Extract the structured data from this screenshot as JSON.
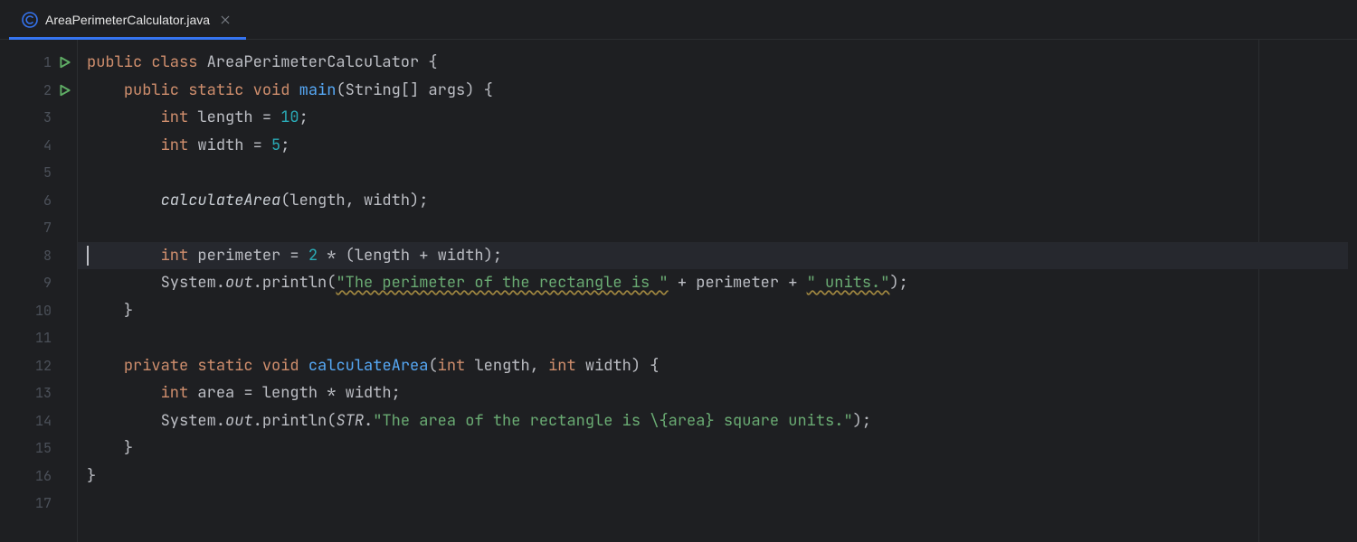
{
  "tab": {
    "title": "AreaPerimeterCalculator.java",
    "icon": "class-icon",
    "close": "×"
  },
  "gutter": {
    "lines": [
      "1",
      "2",
      "3",
      "4",
      "5",
      "6",
      "7",
      "8",
      "9",
      "10",
      "11",
      "12",
      "13",
      "14",
      "15",
      "16",
      "17"
    ],
    "run_markers": [
      1,
      2
    ]
  },
  "current_line": 8,
  "code": {
    "l1": {
      "kw_public": "public",
      "kw_class": "class",
      "cls": "AreaPerimeterCalculator",
      "brace": " {"
    },
    "l2": {
      "indent": "    ",
      "kw_public": "public",
      "kw_static": "static",
      "kw_void": "void",
      "mname": "main",
      "args": "(String[] args) {"
    },
    "l3": {
      "indent": "        ",
      "kw": "int",
      "rest": " length = ",
      "num": "10",
      "semi": ";"
    },
    "l4": {
      "indent": "        ",
      "kw": "int",
      "rest": " width = ",
      "num": "5",
      "semi": ";"
    },
    "l5": {
      "blank": ""
    },
    "l6": {
      "indent": "        ",
      "call": "calculateArea",
      "rest": "(length, width);"
    },
    "l7": {
      "blank": ""
    },
    "l8": {
      "indent": "        ",
      "kw": "int",
      "rest": " perimeter = ",
      "num": "2",
      "tail": " * (length + width);"
    },
    "l9": {
      "indent": "        ",
      "sys": "System.",
      "out": "out",
      "dot": ".",
      "pln": "println",
      "open": "(",
      "s1": "\"The perimeter of the rectangle is \"",
      "mid": " + perimeter + ",
      "s2": "\" units.\"",
      "close": ");"
    },
    "l10": {
      "indent": "    ",
      "brace": "}"
    },
    "l11": {
      "blank": ""
    },
    "l12": {
      "indent": "    ",
      "kw_private": "private",
      "kw_static": "static",
      "kw_void": "void",
      "mname": "calculateArea",
      "args": "(",
      "kw_int1": "int",
      "a1": " length, ",
      "kw_int2": "int",
      "a2": " width) {"
    },
    "l13": {
      "indent": "        ",
      "kw": "int",
      "rest": " area = length * width;"
    },
    "l14": {
      "indent": "        ",
      "sys": "System.",
      "out": "out",
      "dot": ".",
      "pln": "println",
      "open": "(",
      "str": "STR",
      "dot2": ".",
      "s": "\"The area of the rectangle is \\{area} square units.\"",
      "close": ");"
    },
    "l15": {
      "indent": "    ",
      "brace": "}"
    },
    "l16": {
      "brace": "}"
    },
    "l17": {
      "blank": ""
    }
  },
  "colors": {
    "bg": "#1e1f22",
    "accent": "#3574f0",
    "keyword": "#cf8e6d",
    "method": "#56a8f5",
    "number": "#2aabb7",
    "string": "#6aab73"
  }
}
